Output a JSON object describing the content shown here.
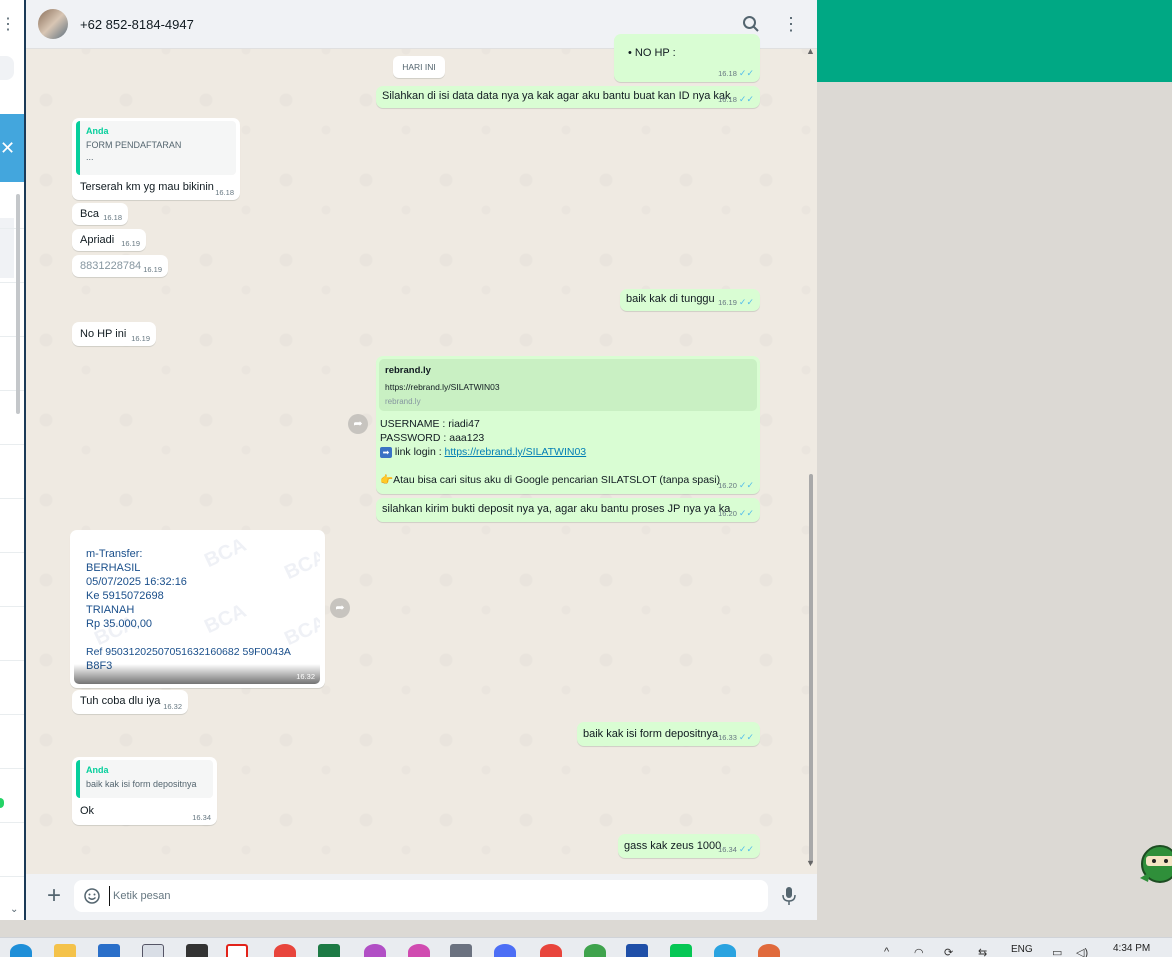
{
  "header": {
    "contact_name": "+62 852-8184-4947"
  },
  "day_chip": "HARI INI",
  "messages": {
    "m1": {
      "text": "• NO HP :",
      "time": "16.18"
    },
    "m2": {
      "text": "Silahkan di isi data data nya ya kak agar aku bantu buat kan ID nya kak",
      "time": "16.18"
    },
    "m3": {
      "quote_author": "Anda",
      "quote_text": "FORM PENDAFTARAN",
      "quote_more": "...",
      "text": "Terserah km yg mau bikinin",
      "time": "16.18"
    },
    "m4": {
      "text": "Bca",
      "time": "16.18"
    },
    "m5": {
      "text": "Apriadi",
      "time": "16.19"
    },
    "m6": {
      "text": "8831228784",
      "time": "16.19"
    },
    "m7": {
      "text": "baik kak di tunggu",
      "time": "16.19"
    },
    "m8": {
      "text": "No HP ini",
      "time": "16.19"
    },
    "m9": {
      "link_title": "rebrand.ly",
      "link_url": "https://rebrand.ly/SILATWIN03",
      "link_domain": "rebrand.ly",
      "username_line": "USERNAME : riadi47",
      "password_line": "PASSWORD : aaa123",
      "login_prefix": "link login : ",
      "login_link": "https://rebrand.ly/SILATWIN03",
      "hint": "Atau bisa cari situs aku di Google pencarian SILATSLOT (tanpa spasi)",
      "time": "16.20"
    },
    "m10": {
      "text": "silahkan kirim bukti deposit nya ya, agar aku bantu proses JP nya ya ka",
      "time": "16.20"
    },
    "m11": {
      "receipt_lines": [
        "m-Transfer:",
        "BERHASIL",
        "05/07/2025 16:32:16",
        "Ke 5915072698",
        "TRIANAH",
        "Rp 35.000,00",
        "",
        "Ref 95031202507051632160682 59F0043A",
        "B8F3"
      ],
      "watermark": "BCA",
      "time": "16.32"
    },
    "m12": {
      "text": "Tuh coba dlu iya",
      "time": "16.32"
    },
    "m13": {
      "text": "baik kak isi form depositnya",
      "time": "16.33"
    },
    "m14": {
      "quote_author": "Anda",
      "quote_text": "baik kak isi form depositnya",
      "text": "Ok",
      "time": "16.34"
    },
    "m15": {
      "text": "gass kak zeus 1000",
      "time": "16.34"
    }
  },
  "composer": {
    "placeholder": "Ketik pesan"
  },
  "taskbar": {
    "lang": "ENG",
    "time": "4:34 PM"
  },
  "colors": {
    "accent": "#00a884",
    "outgoing": "#d9fdd3",
    "incoming": "#ffffff",
    "tick_blue": "#53bdeb",
    "link": "#027eb5"
  },
  "icons": [
    "search-icon",
    "menu-icon",
    "plus-icon",
    "emoji-icon",
    "mic-icon",
    "forward-icon",
    "close-icon",
    "read-ticks-icon"
  ]
}
